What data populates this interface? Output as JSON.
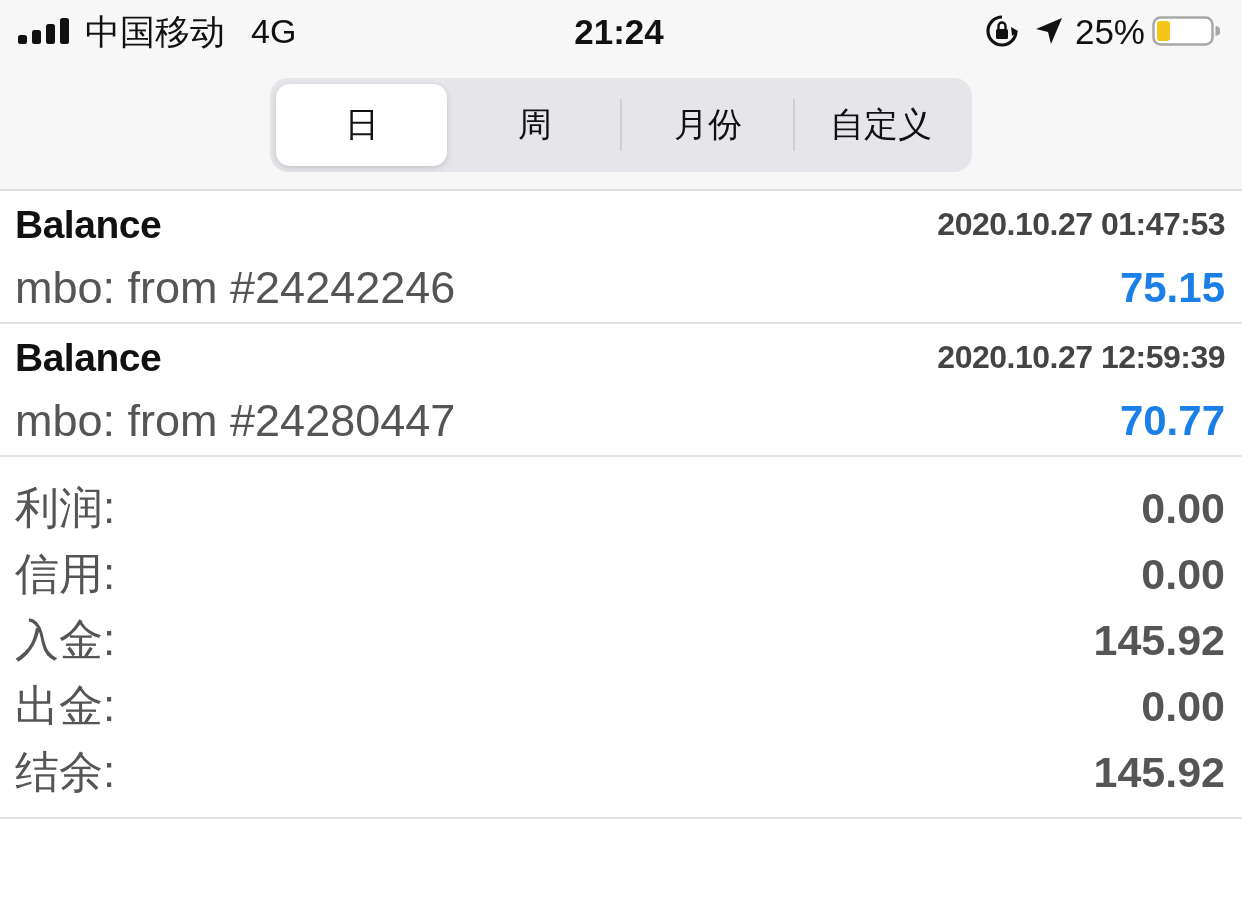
{
  "status_bar": {
    "carrier": "中国移动",
    "network": "4G",
    "time": "21:24",
    "battery": "25%"
  },
  "tabs": [
    {
      "label": "日",
      "selected": true
    },
    {
      "label": "周",
      "selected": false
    },
    {
      "label": "月份",
      "selected": false
    },
    {
      "label": "自定义",
      "selected": false
    }
  ],
  "deals": [
    {
      "type": "Balance",
      "time": "2020.10.27 01:47:53",
      "comment": "mbo: from #24242246",
      "amount": "75.15"
    },
    {
      "type": "Balance",
      "time": "2020.10.27 12:59:39",
      "comment": "mbo: from #24280447",
      "amount": "70.77"
    }
  ],
  "summary": [
    {
      "label": "利润:",
      "value": "0.00"
    },
    {
      "label": "信用:",
      "value": "0.00"
    },
    {
      "label": "入金:",
      "value": "145.92"
    },
    {
      "label": "出金:",
      "value": "0.00"
    },
    {
      "label": "结余:",
      "value": "145.92"
    }
  ]
}
